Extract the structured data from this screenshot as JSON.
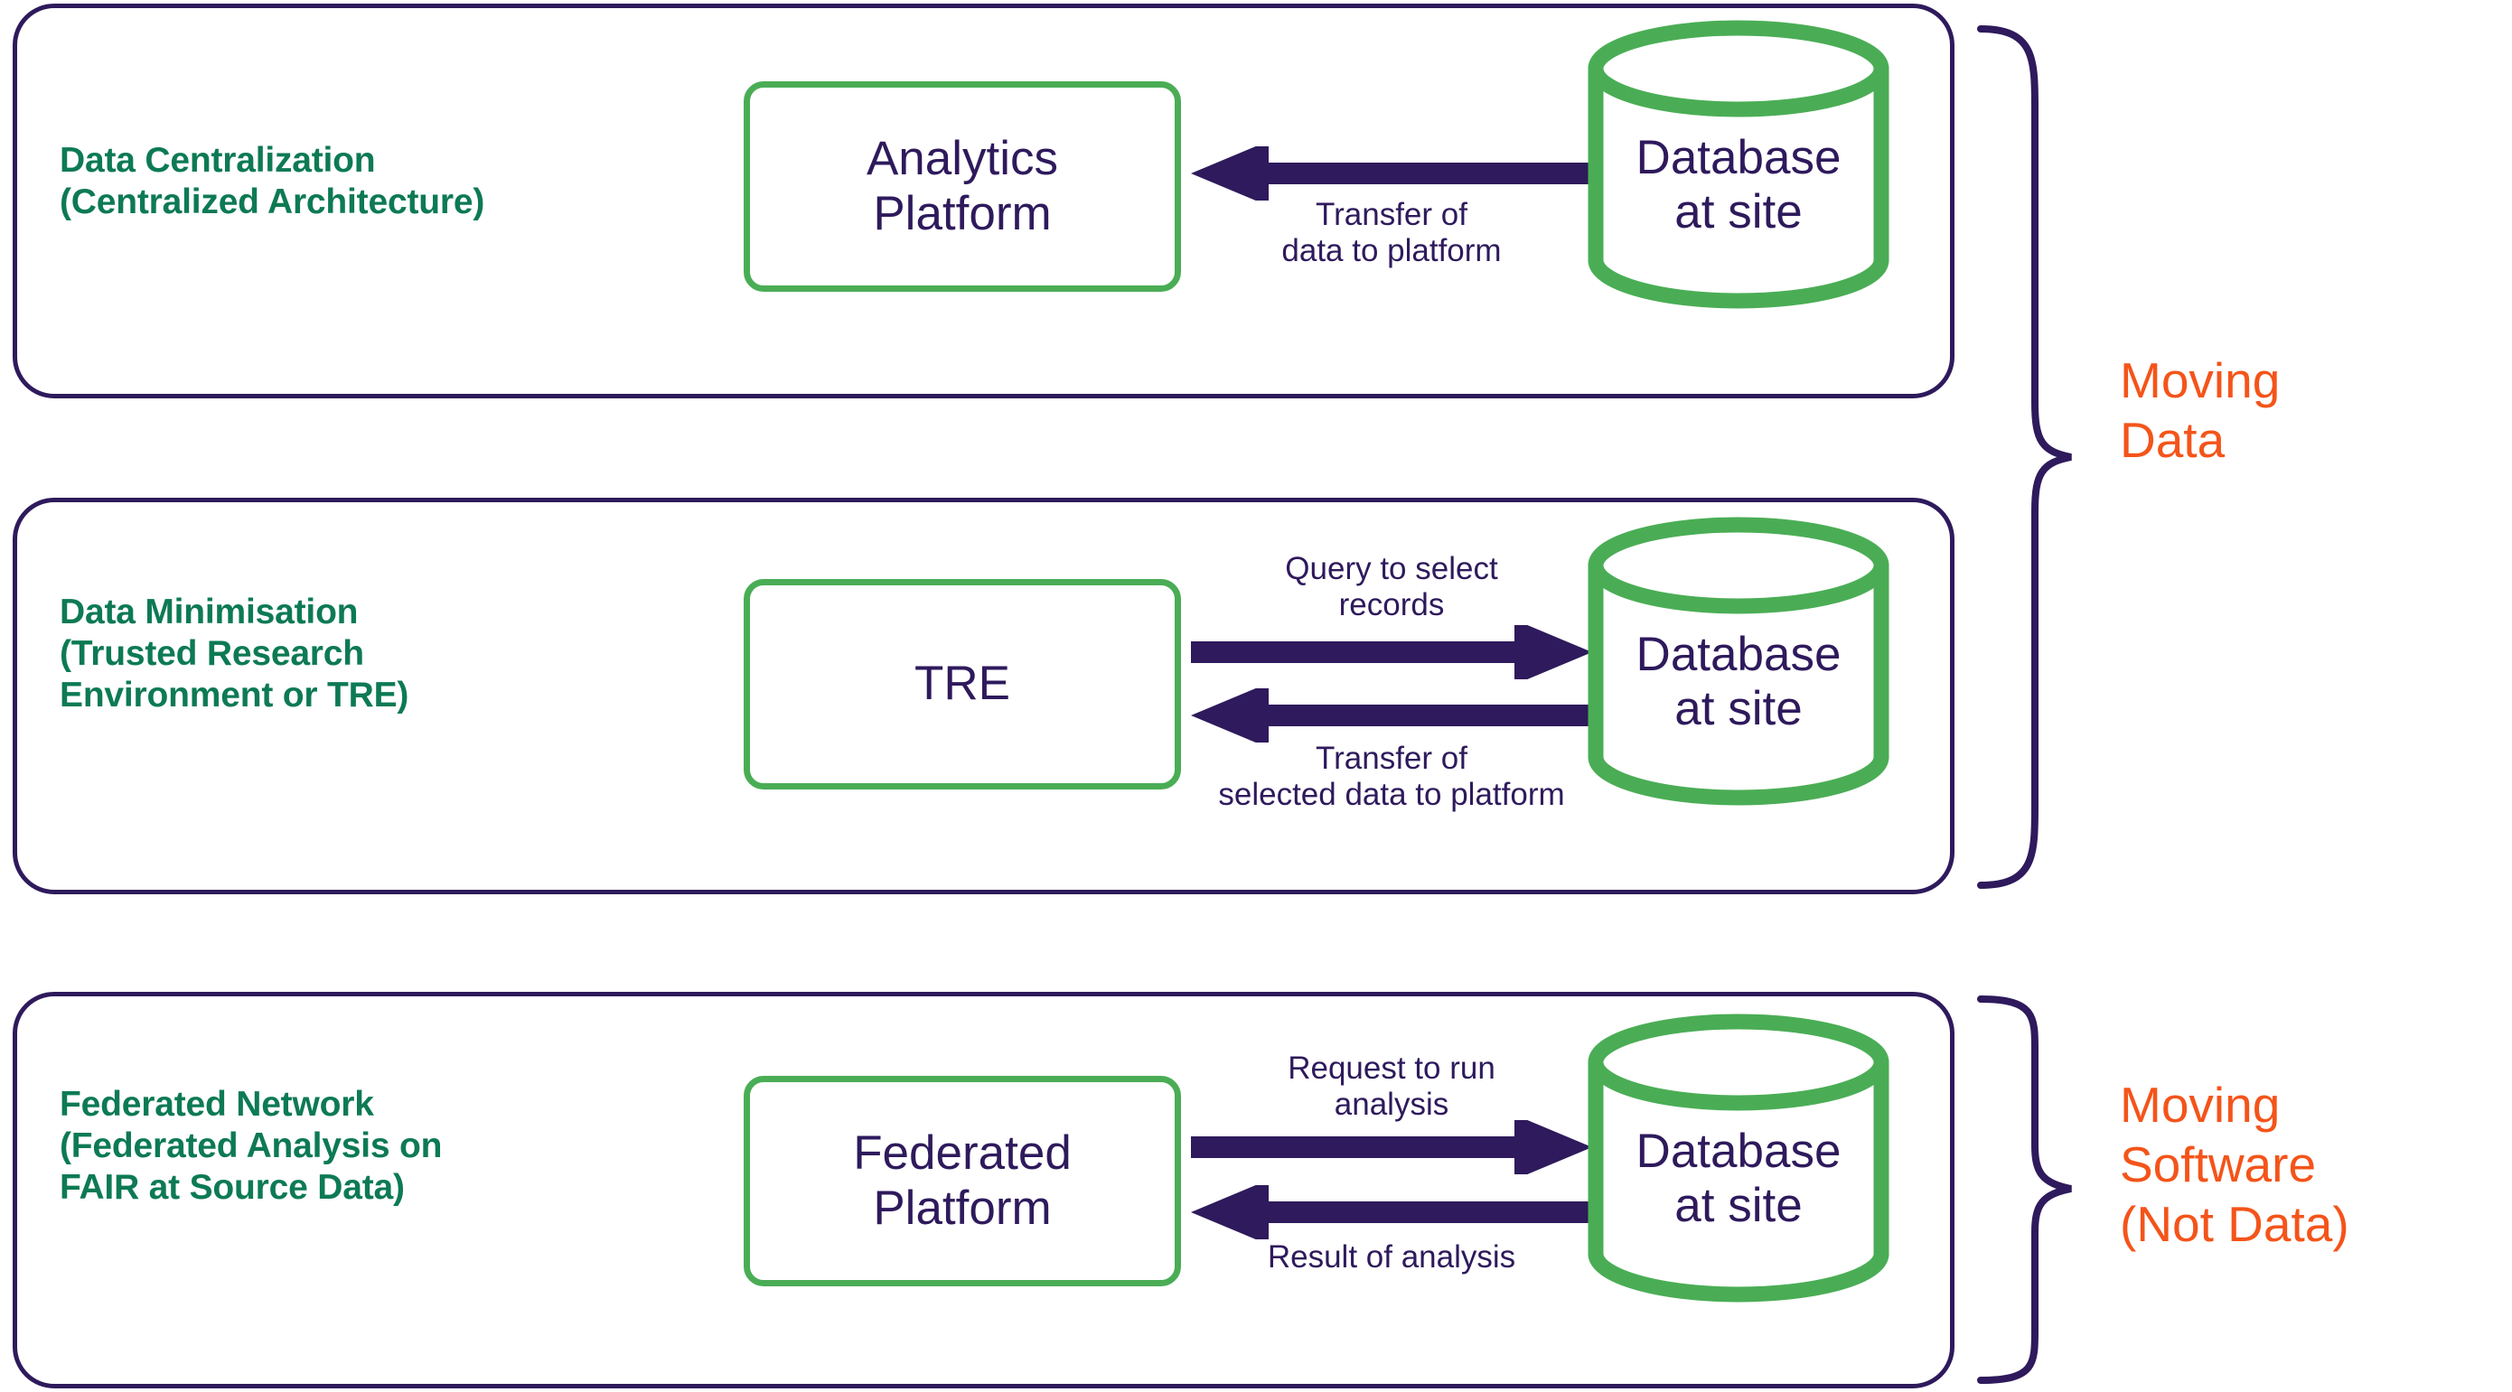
{
  "colors": {
    "panel_border": "#2e1a5c",
    "heading_green": "#0d7a54",
    "box_green": "#4aad55",
    "arrow_purple": "#2e1a5c",
    "group_orange": "#f4541a",
    "background": "#ffffff"
  },
  "rows": [
    {
      "approach_label": "Data Centralization\n(Centralized Architecture)",
      "platform": "Analytics\nPlatform",
      "database": "Database\nat site",
      "arrows": [
        {
          "direction": "left",
          "caption": "Transfer of\ndata to platform"
        }
      ]
    },
    {
      "approach_label": "Data Minimisation\n(Trusted Research\nEnvironment or TRE)",
      "platform": "TRE",
      "database": "Database\nat site",
      "arrows": [
        {
          "direction": "right",
          "caption": "Query to select\nrecords"
        },
        {
          "direction": "left",
          "caption": "Transfer of\nselected data to platform"
        }
      ]
    },
    {
      "approach_label": "Federated Network\n(Federated Analysis on\nFAIR at Source Data)",
      "platform": "Federated\nPlatform",
      "database": "Database\nat site",
      "arrows": [
        {
          "direction": "right",
          "caption": "Request to run\nanalysis"
        },
        {
          "direction": "left",
          "caption": "Result of analysis"
        }
      ]
    }
  ],
  "groups": [
    {
      "label": "Moving\nData",
      "covers": "rows 1-2"
    },
    {
      "label": "Moving\nSoftware\n(Not Data)",
      "covers": "row 3"
    }
  ]
}
